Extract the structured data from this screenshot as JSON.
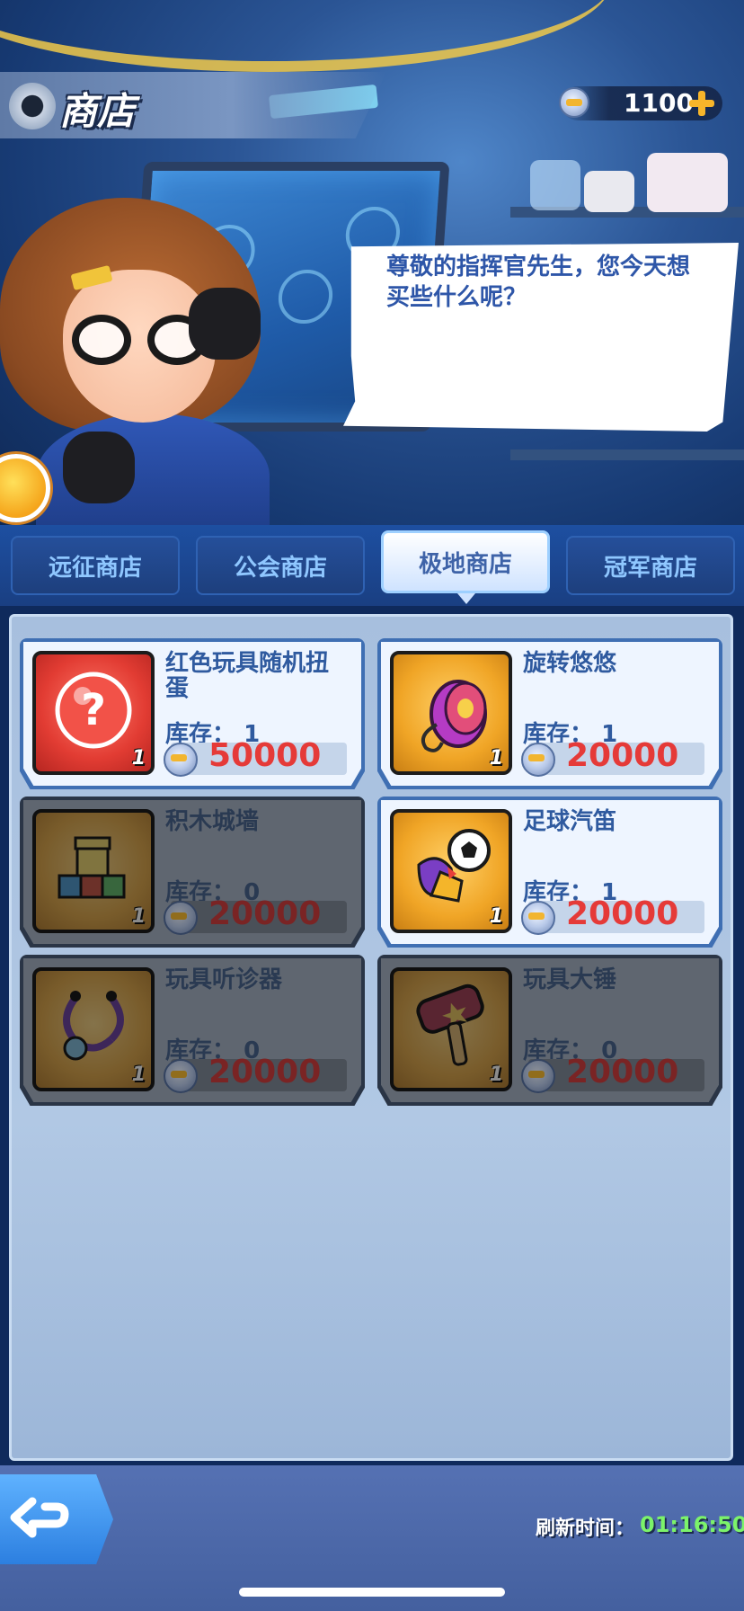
{
  "header": {
    "title": "商店",
    "currency_amount": "1100"
  },
  "npc": {
    "dialog": "尊敬的指挥官先生，您今天想买些什么呢？"
  },
  "tabs": [
    {
      "label": "远征商店",
      "active": false
    },
    {
      "label": "公会商店",
      "active": false
    },
    {
      "label": "极地商店",
      "active": true
    },
    {
      "label": "冠军商店",
      "active": false
    }
  ],
  "items": [
    {
      "name": "红色玩具随机扭蛋",
      "stock_label": "库存：",
      "stock": "1",
      "price": "50000",
      "qty": "1",
      "available": true,
      "icon": "red-capsule-icon"
    },
    {
      "name": "旋转悠悠",
      "stock_label": "库存：",
      "stock": "1",
      "price": "20000",
      "qty": "1",
      "available": true,
      "icon": "yoyo-icon"
    },
    {
      "name": "积木城墙",
      "stock_label": "库存：",
      "stock": "0",
      "price": "20000",
      "qty": "1",
      "available": false,
      "icon": "block-wall-icon"
    },
    {
      "name": "足球汽笛",
      "stock_label": "库存：",
      "stock": "1",
      "price": "20000",
      "qty": "1",
      "available": true,
      "icon": "soccer-whistle-icon"
    },
    {
      "name": "玩具听诊器",
      "stock_label": "库存：",
      "stock": "0",
      "price": "20000",
      "qty": "1",
      "available": false,
      "icon": "stethoscope-icon"
    },
    {
      "name": "玩具大锤",
      "stock_label": "库存：",
      "stock": "0",
      "price": "20000",
      "qty": "1",
      "available": false,
      "icon": "hammer-icon"
    }
  ],
  "footer": {
    "refresh_label": "刷新时间：",
    "refresh_time": "01:16:50"
  }
}
